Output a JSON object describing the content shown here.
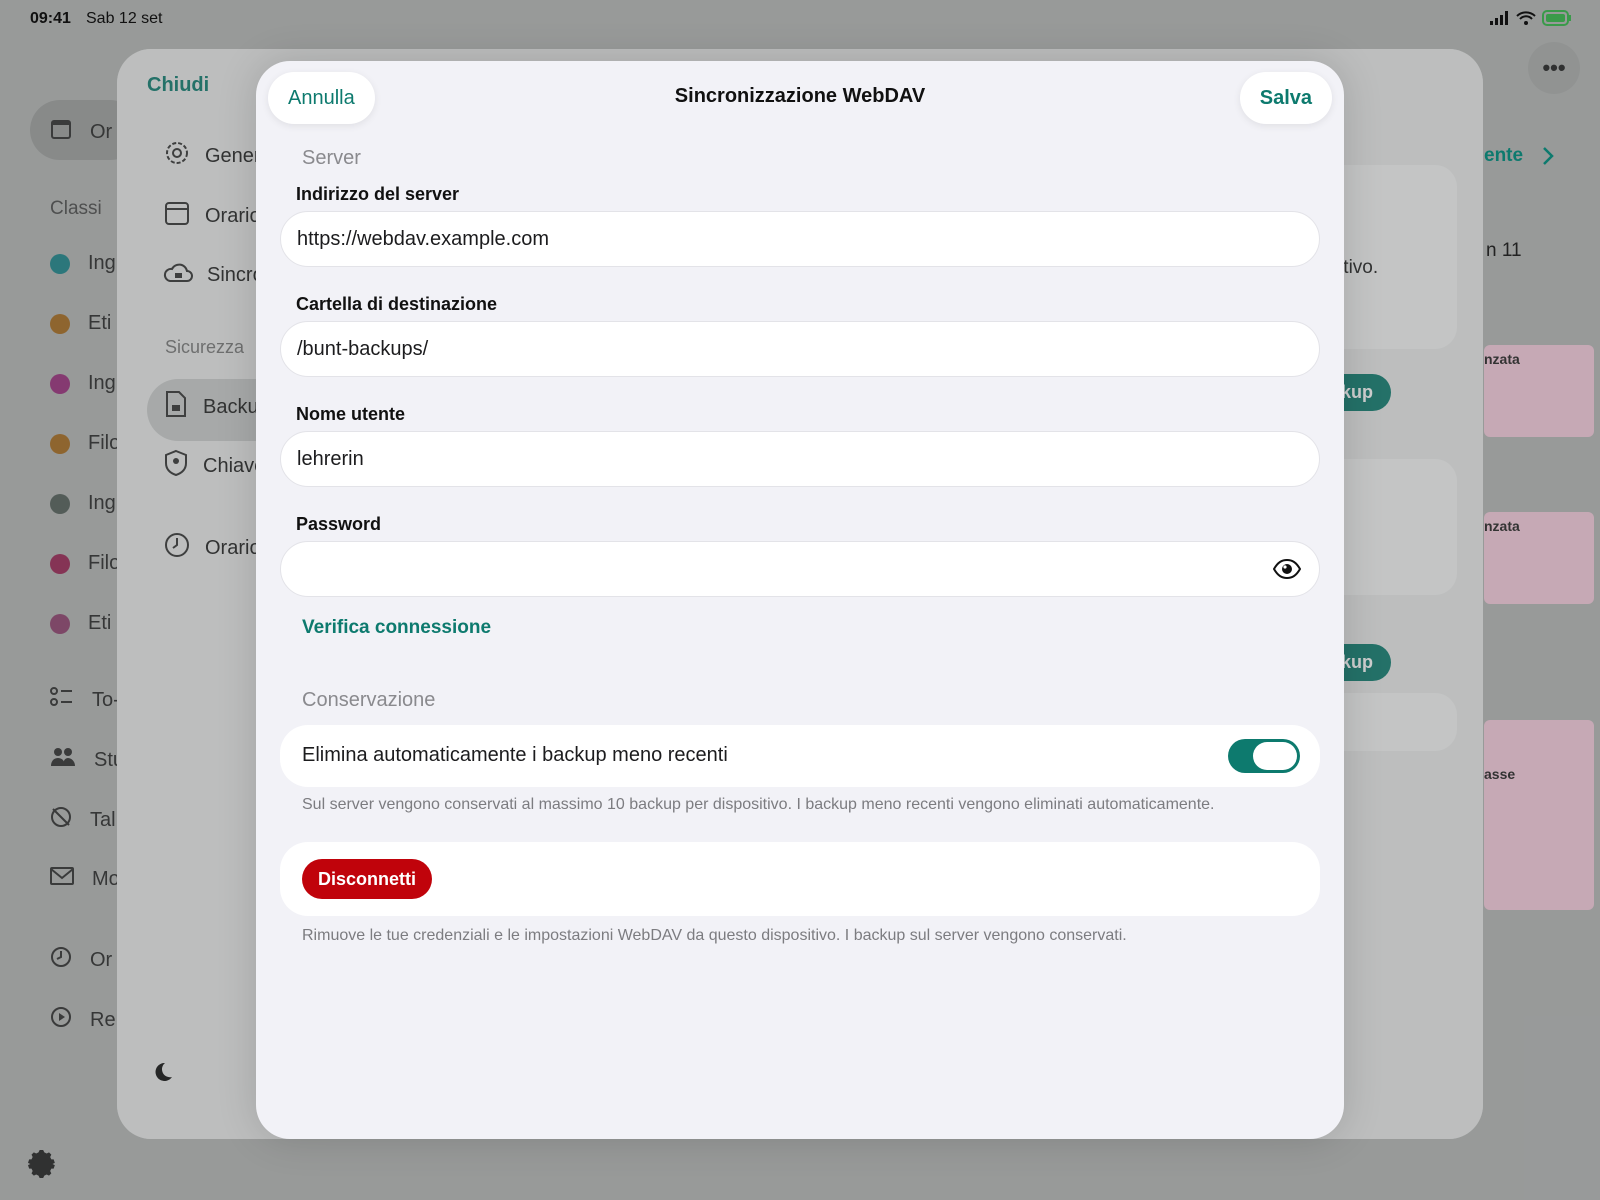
{
  "status_bar": {
    "time": "09:41",
    "date": "Sab 12 set"
  },
  "background_app": {
    "sidebar_selected": "Or",
    "classes_header": "Classi",
    "classes": [
      {
        "label": "Ing",
        "color": "#1a9aa0"
      },
      {
        "label": "Eti",
        "color": "#c37a1e"
      },
      {
        "label": "Ing",
        "color": "#b4318f"
      },
      {
        "label": "Filo",
        "color": "#c37a1e"
      },
      {
        "label": "Ing",
        "color": "#5e6b64"
      },
      {
        "label": "Filo",
        "color": "#b4265f"
      },
      {
        "label": "Eti",
        "color": "#a6487e"
      }
    ],
    "tools": [
      "To-",
      "Stu",
      "Tal",
      "Mo"
    ],
    "bottom_items": [
      "Or",
      "Re"
    ],
    "right_fragments": {
      "nav_label": "ente",
      "text_1": "ositivo.",
      "text_2": "n 11",
      "tag_1": "nzata",
      "tag_2": "nzata",
      "tag_3": "asse",
      "backup_button_1": "a backup",
      "backup_button_2": "a backup"
    }
  },
  "settings": {
    "close_label": "Chiudi",
    "items": [
      "Gener",
      "Orario",
      "Sincro"
    ],
    "security_header": "Sicurezza",
    "security_items": [
      "Backu",
      "Chiave"
    ],
    "other_items": [
      "Orario"
    ]
  },
  "modal": {
    "title": "Sincronizzazione WebDAV",
    "cancel_label": "Annulla",
    "save_label": "Salva",
    "server_section": "Server",
    "fields": {
      "server_address": {
        "label": "Indirizzo del server",
        "value": "https://webdav.example.com"
      },
      "destination_folder": {
        "label": "Cartella di destinazione",
        "value": "/bunt-backups/"
      },
      "username": {
        "label": "Nome utente",
        "value": "lehrerin"
      },
      "password": {
        "label": "Password",
        "value": ""
      }
    },
    "verify_link": "Verifica connessione",
    "retention_section": "Conservazione",
    "auto_delete_label": "Elimina automaticamente i backup meno recenti",
    "auto_delete_on": true,
    "retention_note": "Sul server vengono conservati al massimo 10 backup per dispositivo. I backup meno recenti vengono eliminati automaticamente.",
    "disconnect_label": "Disconnetti",
    "disconnect_note": "Rimuove le tue credenziali e le impostazioni WebDAV da questo dispositivo. I backup sul server vengono conservati."
  },
  "colors": {
    "accent": "#0d7a6e",
    "danger": "#c0030b"
  }
}
